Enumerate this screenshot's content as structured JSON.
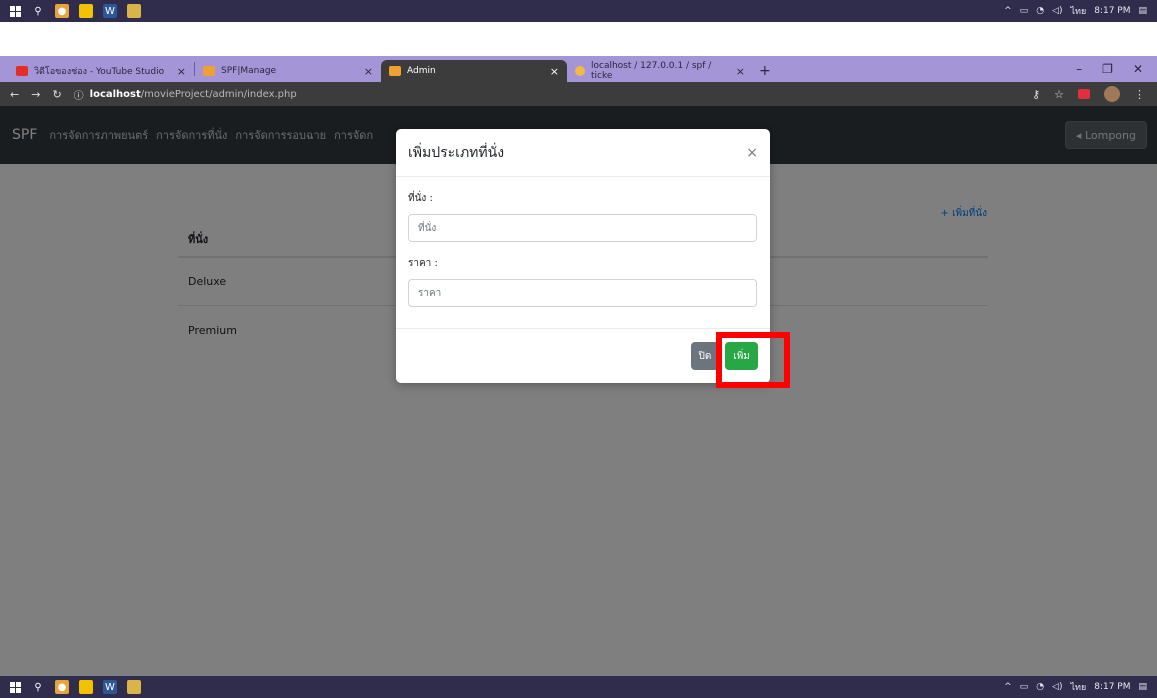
{
  "taskbar": {
    "tray_lang": "ไทย",
    "clock": "8:17 PM"
  },
  "browser": {
    "tabs": [
      {
        "label": "วิดีโอของช่อง - YouTube Studio",
        "active": false
      },
      {
        "label": "SPF|Manage",
        "active": false
      },
      {
        "label": "Admin",
        "active": true
      },
      {
        "label": "localhost / 127.0.0.1 / spf / ticke",
        "active": false
      }
    ],
    "url_host": "localhost",
    "url_path": "/movieProject/admin/index.php"
  },
  "navbar": {
    "brand": "SPF",
    "links": [
      "การจัดการภาพยนตร์",
      "การจัดการที่นั่ง",
      "การจัดการรอบฉาย",
      "การจัดก"
    ],
    "user_button": "◂ Lompong"
  },
  "content": {
    "add_seat_link": "+ เพิ่มที่นั่ง",
    "table_header": "ที่นั่ง",
    "rows": [
      "Deluxe",
      "Premium"
    ]
  },
  "modal": {
    "title": "เพิ่มประเภทที่นั่ง",
    "close_symbol": "×",
    "seat_label": "ที่นั่ง :",
    "seat_placeholder": "ที่นั่ง",
    "price_label": "ราคา :",
    "price_placeholder": "ราคา",
    "close_button": "ปิด",
    "add_button": "เพิ่ม"
  },
  "colors": {
    "highlight": "#ff0000",
    "add_button": "#28a745",
    "close_button": "#6c757d",
    "navbar": "#343a40",
    "tabstrip": "#a496d6"
  }
}
